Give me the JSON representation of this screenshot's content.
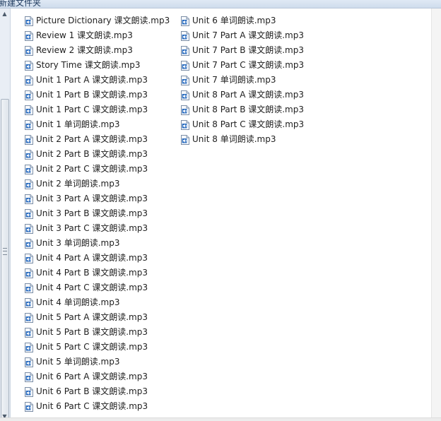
{
  "window": {
    "title": "新建文件夹"
  },
  "file_icon": "audio-file-icon",
  "columns": [
    [
      "Picture Dictionary 课文朗读.mp3",
      "Review 1 课文朗读.mp3",
      "Review 2 课文朗读.mp3",
      "Story Time 课文朗读.mp3",
      "Unit 1 Part A 课文朗读.mp3",
      "Unit 1 Part B 课文朗读.mp3",
      "Unit 1 Part C 课文朗读.mp3",
      "Unit 1 单词朗读.mp3",
      "Unit 2 Part A 课文朗读.mp3",
      "Unit 2 Part B 课文朗读.mp3",
      "Unit 2 Part C 课文朗读.mp3",
      "Unit 2 单词朗读.mp3",
      "Unit 3 Part A 课文朗读.mp3",
      "Unit 3 Part B 课文朗读.mp3",
      "Unit 3 Part C 课文朗读.mp3",
      "Unit 3 单词朗读.mp3",
      "Unit 4 Part A 课文朗读.mp3",
      "Unit 4 Part B 课文朗读.mp3",
      "Unit 4 Part C 课文朗读.mp3",
      "Unit 4 单词朗读.mp3",
      "Unit 5 Part A 课文朗读.mp3",
      "Unit 5 Part B 课文朗读.mp3",
      "Unit 5 Part C 课文朗读.mp3",
      "Unit 5 单词朗读.mp3",
      "Unit 6 Part A 课文朗读.mp3",
      "Unit 6 Part B 课文朗读.mp3",
      "Unit 6 Part C 课文朗读.mp3"
    ],
    [
      "Unit 6 单词朗读.mp3",
      "Unit 7 Part A 课文朗读.mp3",
      "Unit 7 Part B 课文朗读.mp3",
      "Unit 7 Part C 课文朗读.mp3",
      "Unit 7 单词朗读.mp3",
      "Unit 8 Part A 课文朗读.mp3",
      "Unit 8 Part B 课文朗读.mp3",
      "Unit 8 Part C 课文朗读.mp3",
      "Unit 8 单词朗读.mp3"
    ]
  ]
}
